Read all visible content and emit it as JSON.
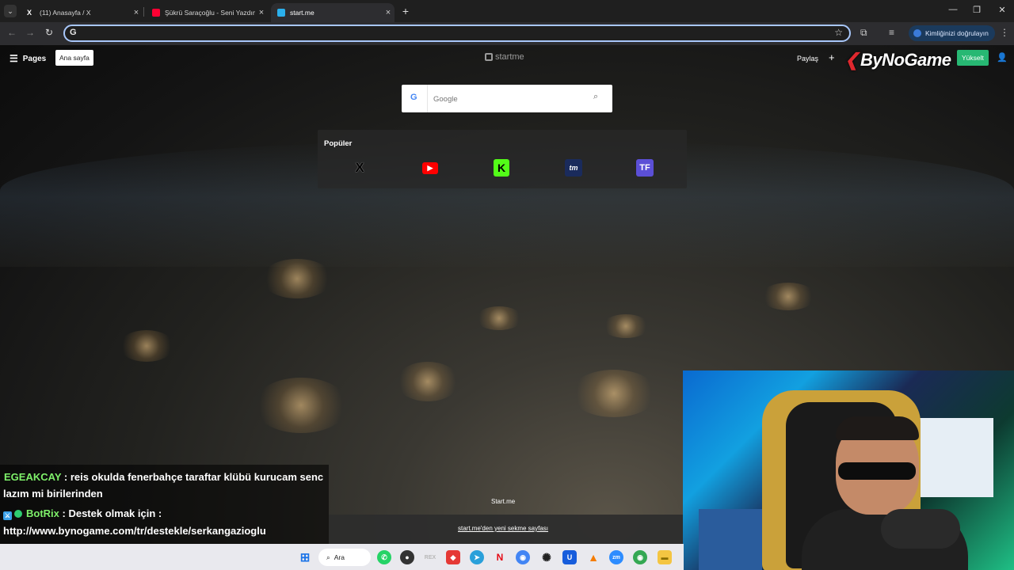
{
  "browser": {
    "tabs": [
      {
        "title": "(11) Anasayfa / X",
        "icon": "x-logo-icon",
        "active": false
      },
      {
        "title": "Şükrü Saraçoğlu - Seni Yazdım |",
        "icon": "youtube-icon",
        "active": false
      },
      {
        "title": "start.me",
        "icon": "startme-icon",
        "active": true
      }
    ],
    "new_tab": "+",
    "omnibox_value": "",
    "omnibox_icon": "G",
    "verify_label": "Kimliğinizi doğrulayın"
  },
  "page": {
    "menu_label": "Pages",
    "home_chip": "Ana sayfa",
    "logo_text": "startme",
    "share_label": "Paylaş",
    "add_label": "+",
    "overlay_brand": "ByNoGame",
    "upgrade_label": "Yükselt",
    "search": {
      "placeholder": "Google",
      "engine_icon": "G"
    },
    "popular": {
      "title": "Popüler",
      "bookmarks": [
        {
          "label": "X",
          "icon": "x-bookmark-icon",
          "bg": "",
          "fg": "#000000"
        },
        {
          "label": "▶",
          "icon": "youtube-bookmark-icon",
          "bg": "#ff0000",
          "fg": "#ffffff"
        },
        {
          "label": "K",
          "icon": "kick-bookmark-icon",
          "bg": "#53fc18",
          "fg": "#000000"
        },
        {
          "label": "tm",
          "icon": "transfermarkt-bookmark-icon",
          "bg": "#1a2b5c",
          "fg": "#ffffff"
        },
        {
          "label": "TF",
          "icon": "tf-bookmark-icon",
          "bg": "#5b4fd6",
          "fg": "#ffffff"
        }
      ]
    },
    "footer_brand": "Start.me",
    "footer_link": "start.me'den yeni sekme sayfası"
  },
  "chat": [
    {
      "user": "EGEAKCAY",
      "text": ": reis okulda fenerbahçe taraftar klübü kurucam senc",
      "cont": "lazım mi birilerinden"
    },
    {
      "user": "BotRix",
      "text": ": Destek olmak için :",
      "cont": "http://www.bynogame.com/tr/destekle/serkangazioglu"
    }
  ],
  "taskbar": {
    "search_label": "Ara",
    "apps": [
      {
        "icon": "windows-start-icon",
        "glyph": "⊞",
        "color": "#1a73e8"
      },
      {
        "icon": "whatsapp-icon",
        "glyph": "✆",
        "color": "#25d366"
      },
      {
        "icon": "app-red-dot-icon",
        "glyph": "●",
        "color": "#333333"
      },
      {
        "icon": "rex-icon",
        "glyph": "REX",
        "color": "#b8b8b8"
      },
      {
        "icon": "anydesk-icon",
        "glyph": "◆",
        "color": "#e53935"
      },
      {
        "icon": "telegram-icon",
        "glyph": "➤",
        "color": "#2aa0da"
      },
      {
        "icon": "netflix-icon",
        "glyph": "N",
        "color": "#e50914"
      },
      {
        "icon": "chrome-icon",
        "glyph": "◉",
        "color": "#4285f4"
      },
      {
        "icon": "chatgpt-icon",
        "glyph": "✺",
        "color": "#222222"
      },
      {
        "icon": "bitwarden-icon",
        "glyph": "U",
        "color": "#175ddc"
      },
      {
        "icon": "vlc-icon",
        "glyph": "▲",
        "color": "#f57c00"
      },
      {
        "icon": "zoom-icon",
        "glyph": "zm",
        "color": "#2d8cff"
      },
      {
        "icon": "chrome-profile-icon",
        "glyph": "◉",
        "color": "#34a853"
      },
      {
        "icon": "file-explorer-icon",
        "glyph": "▬",
        "color": "#f4c542"
      }
    ]
  }
}
